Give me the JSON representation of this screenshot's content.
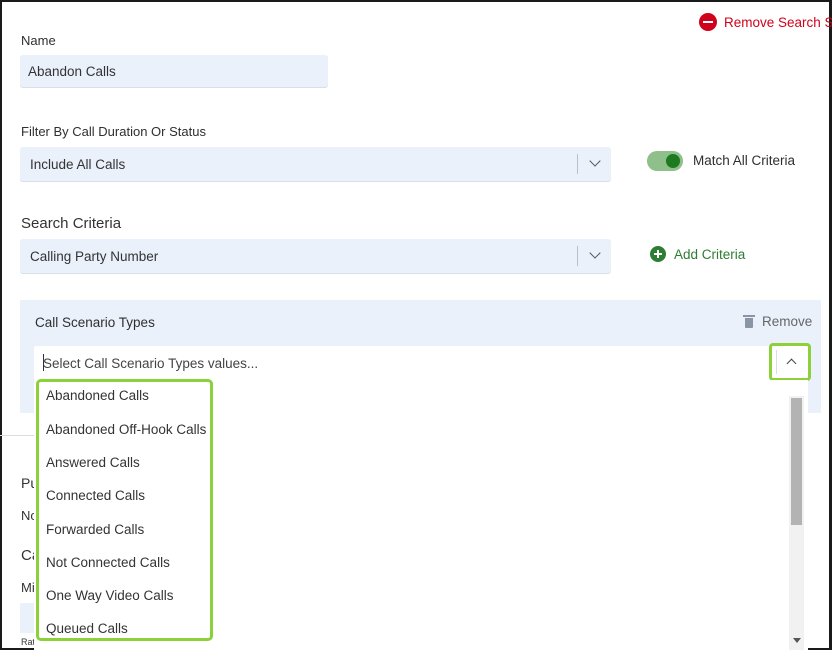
{
  "header": {
    "remove_search_set_label": "Remove Search Set"
  },
  "name_field": {
    "label": "Name",
    "value": "Abandon Calls"
  },
  "filter": {
    "label": "Filter By Call Duration Or Status",
    "selected": "Include All Calls",
    "match_all_label": "Match All Criteria",
    "match_all_enabled": true
  },
  "search_criteria": {
    "title": "Search Criteria",
    "selected": "Calling Party Number",
    "add_label": "Add Criteria"
  },
  "scenario": {
    "title": "Call Scenario Types",
    "remove_label": "Remove",
    "placeholder": "Select Call Scenario Types values...",
    "options": [
      "Abandoned Calls",
      "Abandoned Off-Hook Calls",
      "Answered Calls",
      "Connected Calls",
      "Forwarded Calls",
      "Not Connected Calls",
      "One Way Video Calls",
      "Queued Calls"
    ]
  },
  "background_fragments": {
    "pu": "Pu",
    "no": "No",
    "ca": "Ca",
    "mi": "Mi",
    "rat": "Rat"
  },
  "colors": {
    "accent_green": "#8cd13a",
    "danger_red": "#d0021b",
    "add_green": "#2e7d32",
    "field_bg": "#eaf1fb"
  }
}
